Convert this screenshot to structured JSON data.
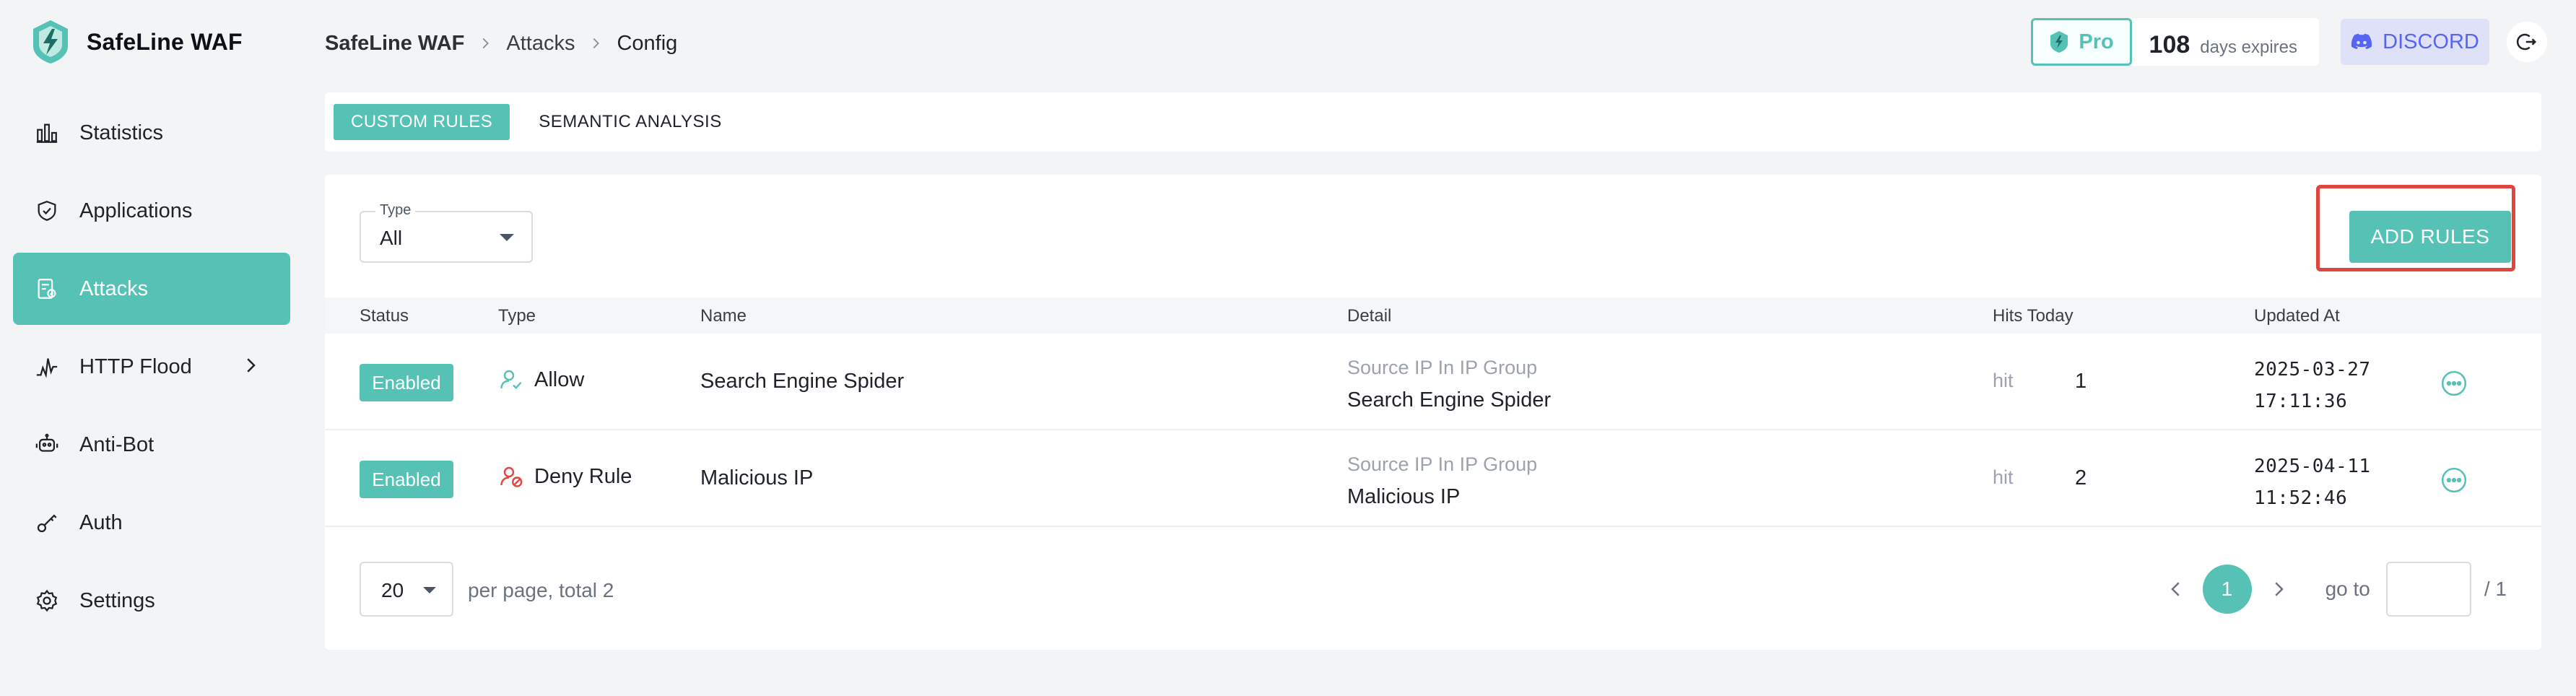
{
  "colors": {
    "accent": "#56c2b6",
    "danger": "#e0463e",
    "discord": "#5865f2"
  },
  "brand": {
    "name": "SafeLine WAF",
    "icon": "safeline-logo-icon"
  },
  "sidebar": {
    "items": [
      {
        "label": "Statistics",
        "icon": "bar-chart-icon",
        "active": false
      },
      {
        "label": "Applications",
        "icon": "shield-icon",
        "active": false
      },
      {
        "label": "Attacks",
        "icon": "attack-doc-icon",
        "active": true
      },
      {
        "label": "HTTP Flood",
        "icon": "pulse-icon",
        "active": false,
        "has_submenu": true
      },
      {
        "label": "Anti-Bot",
        "icon": "robot-icon",
        "active": false
      },
      {
        "label": "Auth",
        "icon": "key-icon",
        "active": false
      },
      {
        "label": "Settings",
        "icon": "gear-icon",
        "active": false
      }
    ]
  },
  "breadcrumb": {
    "root": "SafeLine WAF",
    "mid": "Attacks",
    "current": "Config"
  },
  "header": {
    "pro_label": "Pro",
    "days": "108",
    "days_text": "days expires",
    "discord_label": "DISCORD"
  },
  "tabs": [
    {
      "label": "CUSTOM RULES",
      "active": true
    },
    {
      "label": "SEMANTIC ANALYSIS",
      "active": false
    }
  ],
  "filter": {
    "label": "Type",
    "value": "All"
  },
  "add_button": "ADD RULES",
  "table": {
    "columns": [
      "Status",
      "Type",
      "Name",
      "Detail",
      "Hits Today",
      "Updated At"
    ],
    "rows": [
      {
        "status": "Enabled",
        "type": "Allow",
        "type_icon": "allow-user-icon",
        "name": "Search Engine Spider",
        "detail_label": "Source IP In IP Group",
        "detail_value": "Search Engine Spider",
        "hit_label": "hit",
        "hits": "1",
        "updated_date": "2025-03-27",
        "updated_time": "17:11:36"
      },
      {
        "status": "Enabled",
        "type": "Deny Rule",
        "type_icon": "deny-user-icon",
        "name": "Malicious IP",
        "detail_label": "Source IP In IP Group",
        "detail_value": "Malicious IP",
        "hit_label": "hit",
        "hits": "2",
        "updated_date": "2025-04-11",
        "updated_time": "11:52:46"
      }
    ]
  },
  "pagination": {
    "per_page": "20",
    "per_page_text": "per page, total 2",
    "current_page": "1",
    "goto_label": "go to",
    "goto_value": "",
    "of_total": "/ 1"
  }
}
